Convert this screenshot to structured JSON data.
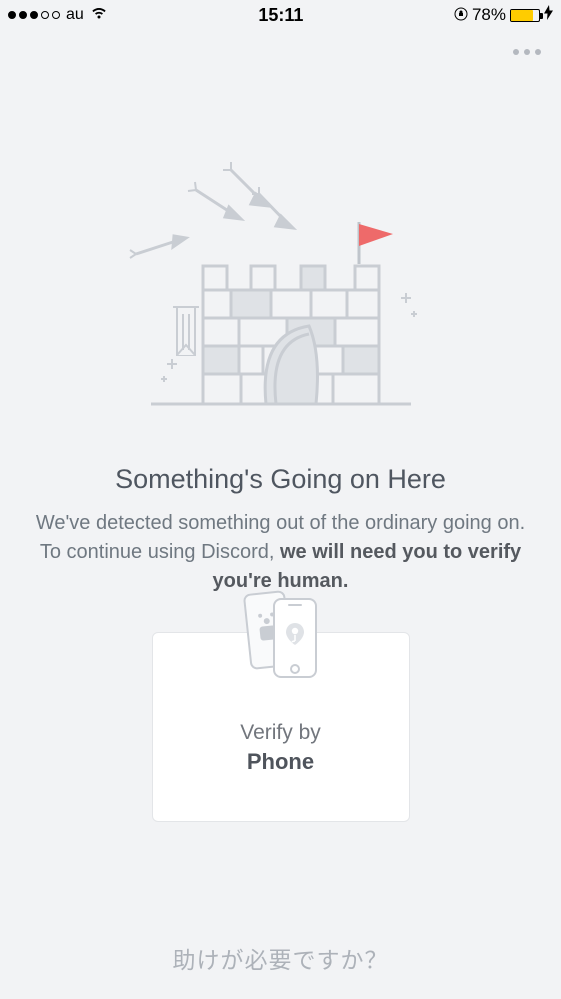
{
  "status_bar": {
    "carrier": "au",
    "time": "15:11",
    "battery_pct": "78%"
  },
  "content": {
    "heading": "Something's Going on Here",
    "body_pre": "We've detected something out of the ordinary going on. To continue using Discord, ",
    "body_bold": "we will need you to verify you're human."
  },
  "verify_card": {
    "label": "Verify by",
    "method": "Phone"
  },
  "help_link": "助けが必要ですか？"
}
